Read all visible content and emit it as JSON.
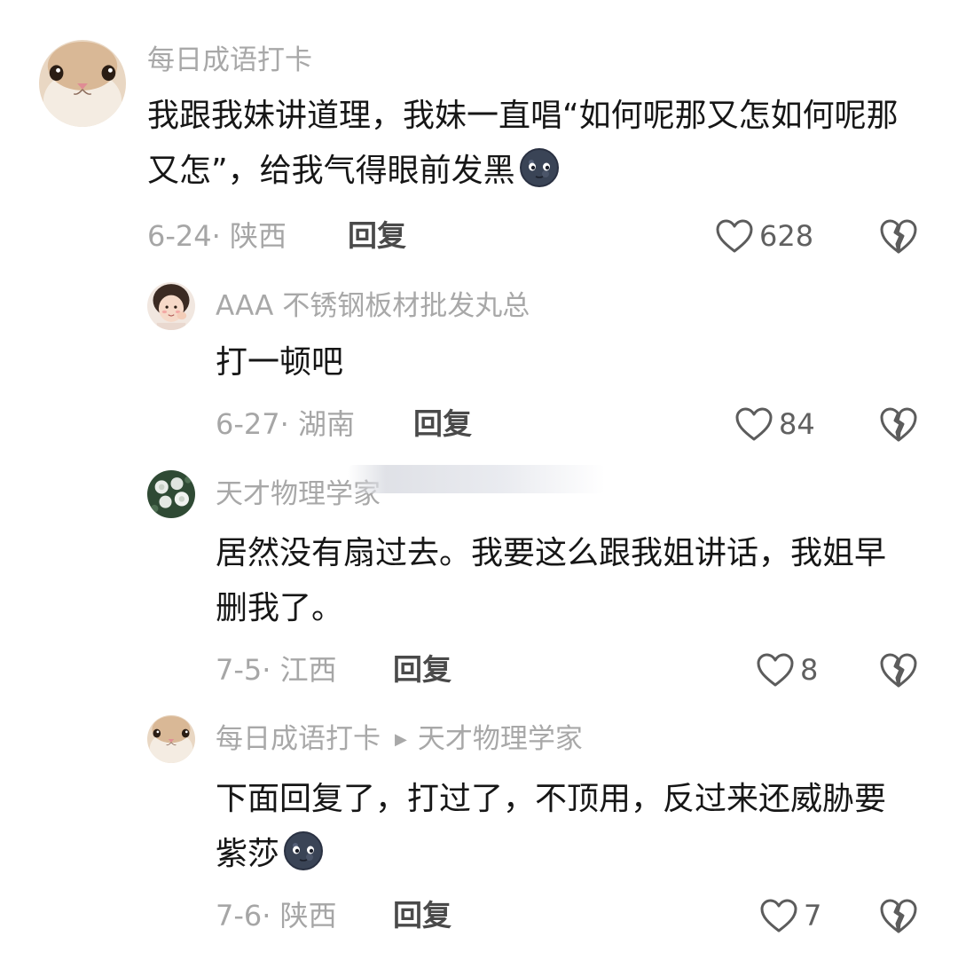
{
  "comments": [
    {
      "author": "每日成语打卡",
      "text": "我跟我妹讲道理，我妹一直唱“如何呢那又怎如何呢那又怎”，给我气得眼前发黑",
      "emoji": "dark-moon-face-emoji",
      "date": "6-24",
      "location": "陕西",
      "reply_label": "回复",
      "likes": "628"
    },
    {
      "author": "AAA 不锈钢板材批发丸总",
      "text": "打一顿吧",
      "date": "6-27",
      "location": "湖南",
      "reply_label": "回复",
      "likes": "84"
    },
    {
      "author": "天才物理学家",
      "text": "居然没有扇过去。我要这么跟我姐讲话，我姐早删我了。",
      "date": "7-5",
      "location": "江西",
      "reply_label": "回复",
      "likes": "8"
    },
    {
      "author": "每日成语打卡",
      "reply_to": "天才物理学家",
      "text": "下面回复了，打过了，不顶用，反过来还威胁要紫莎",
      "emoji": "dark-moon-face-emoji",
      "date": "7-6",
      "location": "陕西",
      "reply_label": "回复",
      "likes": "7"
    }
  ],
  "colors": {
    "meta": "#a6a6a6",
    "text": "#161616",
    "reply": "#4a4a4a"
  },
  "icons": {
    "like": "heart-outline-icon",
    "dislike": "broken-heart-icon"
  }
}
